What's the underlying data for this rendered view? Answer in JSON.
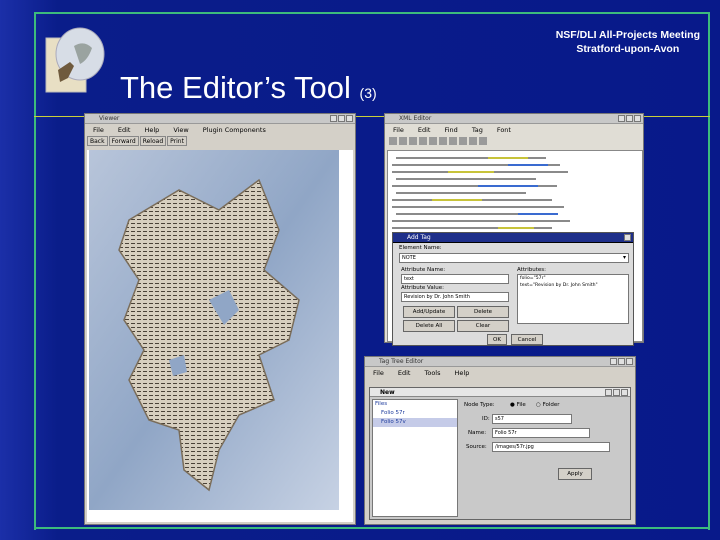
{
  "slide": {
    "header_line1": "NSF/DLI All-Projects Meeting",
    "header_line2": "Stratford-upon-Avon",
    "title": "The Editor’s Tool",
    "title_suffix": "(3)",
    "colors": {
      "background": "#0b1e8c",
      "frame": "#3dbb7c",
      "divider": "#c9cf3a",
      "dialog_title": "#1e2f8a"
    }
  },
  "viewer": {
    "title": "Viewer",
    "menu": [
      "File",
      "Edit",
      "Help",
      "View",
      "Plugin Components"
    ],
    "toolbar": [
      "Back",
      "Forward",
      "Reload",
      "Print"
    ]
  },
  "xml_editor": {
    "title": "XML Editor",
    "menu": [
      "File",
      "Edit",
      "Find",
      "Tag",
      "Font"
    ]
  },
  "add_tag": {
    "title": "Add Tag",
    "element_name_label": "Element Name:",
    "element_name_value": "NOTE",
    "attribute_name_label": "Attribute Name:",
    "attribute_name_value": "text",
    "attribute_value_label": "Attribute Value:",
    "attribute_value_value": "Revision by Dr. John Smith",
    "attributes_label": "Attributes:",
    "attributes_list": [
      "folio=\"57r\"",
      "text=\"Revision by Dr. John Smith\""
    ],
    "buttons": {
      "add_update": "Add/Update",
      "delete": "Delete",
      "delete_all": "Delete All",
      "clear": "Clear",
      "ok": "OK",
      "cancel": "Cancel"
    }
  },
  "tag_tree_editor": {
    "title": "Tag Tree Editor",
    "menu": [
      "File",
      "Edit",
      "Tools",
      "Help"
    ],
    "inner_title": "New",
    "tree_rows": [
      "Files",
      "Folio 57r",
      "Folio 57v"
    ],
    "node_type_label": "Node Type:",
    "node_type_file": "File",
    "node_type_folder": "Folder",
    "id_label": "ID:",
    "id_value": "s57",
    "name_label": "Name:",
    "name_value": "Folio 57r",
    "source_label": "Source:",
    "source_value": "/images/57r.jpg",
    "apply_label": "Apply"
  }
}
